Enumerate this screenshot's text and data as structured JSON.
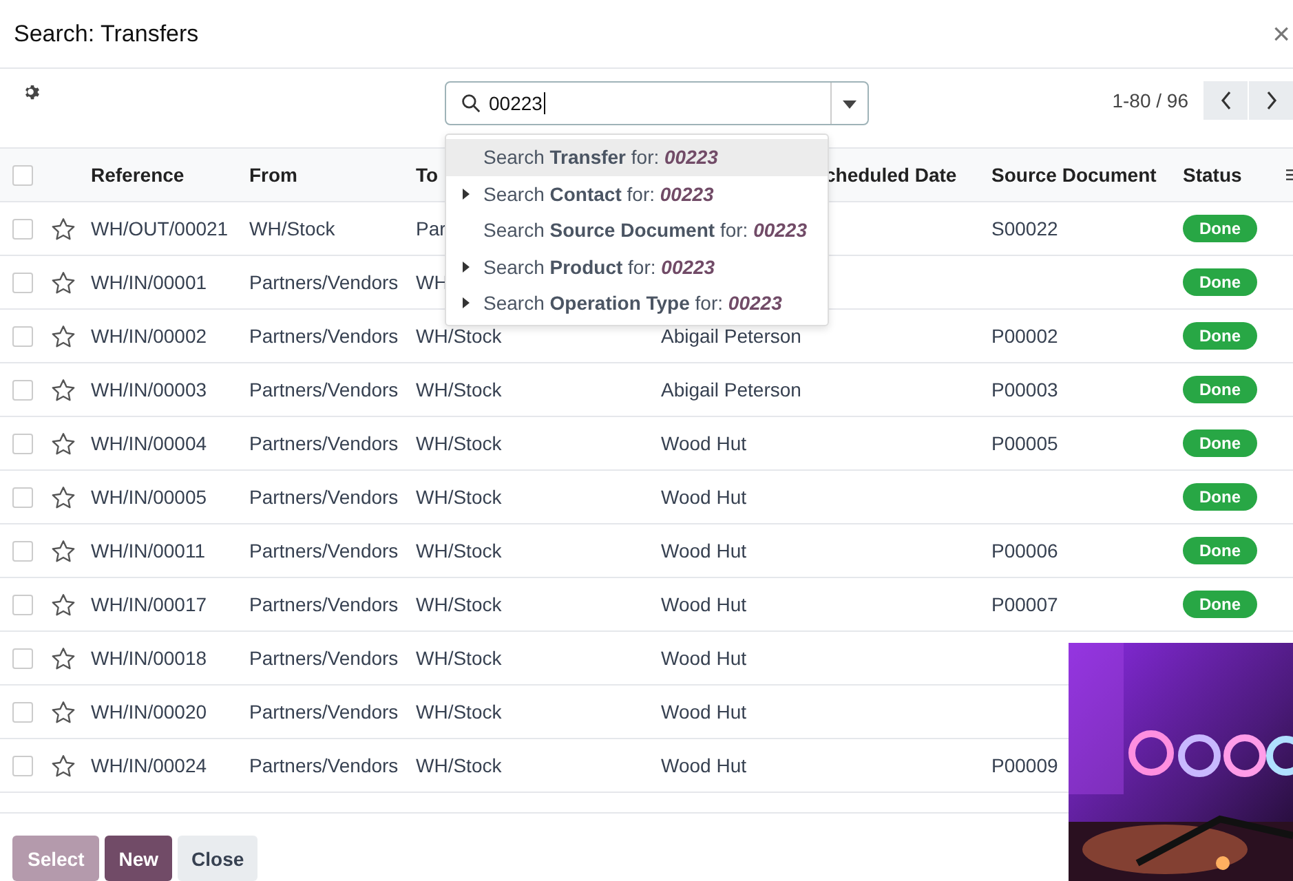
{
  "dialog": {
    "title": "Search: Transfers",
    "close": "×"
  },
  "search": {
    "value": "00223",
    "pager": "1-80 / 96"
  },
  "suggestions": [
    {
      "text": "Search **Transfer** for: *00223*",
      "expandable": false,
      "selected": true
    },
    {
      "text": "Search **Contact** for: *00223*",
      "expandable": true,
      "selected": false
    },
    {
      "text": "Search **Source Document** for: *00223*",
      "expandable": false,
      "selected": false
    },
    {
      "text": "Search **Product** for: *00223*",
      "expandable": true,
      "selected": false
    },
    {
      "text": "Search **Operation Type** for: *00223*",
      "expandable": true,
      "selected": false
    }
  ],
  "table": {
    "all_checked": false,
    "columns": [
      "Reference",
      "From",
      "To",
      "",
      "cheduled Date",
      "Source Document",
      "Status"
    ],
    "rows": [
      {
        "checked": false,
        "starred": false,
        "reference": "WH/OUT/00021",
        "from": "WH/Stock",
        "to": "Par",
        "contact": "",
        "source": "S00022",
        "status": "Done"
      },
      {
        "checked": false,
        "starred": false,
        "reference": "WH/IN/00001",
        "from": "Partners/Vendors",
        "to": "WH",
        "contact": "",
        "source": "",
        "status": "Done"
      },
      {
        "checked": false,
        "starred": false,
        "reference": "WH/IN/00002",
        "from": "Partners/Vendors",
        "to": "WH/Stock",
        "contact": "Abigail Peterson",
        "source": "P00002",
        "status": "Done"
      },
      {
        "checked": false,
        "starred": false,
        "reference": "WH/IN/00003",
        "from": "Partners/Vendors",
        "to": "WH/Stock",
        "contact": "Abigail Peterson",
        "source": "P00003",
        "status": "Done"
      },
      {
        "checked": false,
        "starred": false,
        "reference": "WH/IN/00004",
        "from": "Partners/Vendors",
        "to": "WH/Stock",
        "contact": "Wood Hut",
        "source": "P00005",
        "status": "Done"
      },
      {
        "checked": false,
        "starred": false,
        "reference": "WH/IN/00005",
        "from": "Partners/Vendors",
        "to": "WH/Stock",
        "contact": "Wood Hut",
        "source": "",
        "status": "Done"
      },
      {
        "checked": false,
        "starred": false,
        "reference": "WH/IN/00011",
        "from": "Partners/Vendors",
        "to": "WH/Stock",
        "contact": "Wood Hut",
        "source": "P00006",
        "status": "Done"
      },
      {
        "checked": false,
        "starred": false,
        "reference": "WH/IN/00017",
        "from": "Partners/Vendors",
        "to": "WH/Stock",
        "contact": "Wood Hut",
        "source": "P00007",
        "status": "Done"
      },
      {
        "checked": false,
        "starred": false,
        "reference": "WH/IN/00018",
        "from": "Partners/Vendors",
        "to": "WH/Stock",
        "contact": "Wood Hut",
        "source": "",
        "status": ""
      },
      {
        "checked": false,
        "starred": false,
        "reference": "WH/IN/00020",
        "from": "Partners/Vendors",
        "to": "WH/Stock",
        "contact": "Wood Hut",
        "source": "",
        "status": ""
      },
      {
        "checked": false,
        "starred": false,
        "reference": "WH/IN/00024",
        "from": "Partners/Vendors",
        "to": "WH/Stock",
        "contact": "Wood Hut",
        "source": "P00009",
        "status": ""
      }
    ]
  },
  "buttons": [
    {
      "label": "Select",
      "kind": "disabled"
    },
    {
      "label": "New",
      "kind": "primary"
    },
    {
      "label": "Close",
      "kind": "secondary"
    }
  ]
}
